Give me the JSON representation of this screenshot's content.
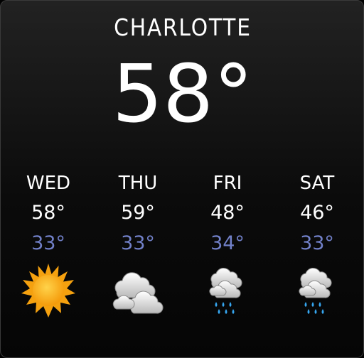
{
  "city": "CHARLOTTE",
  "current_temp": "58°",
  "forecast": [
    {
      "day": "WED",
      "high": "58°",
      "low": "33°",
      "icon": "sun-icon"
    },
    {
      "day": "THU",
      "high": "59°",
      "low": "33°",
      "icon": "cloudy-icon"
    },
    {
      "day": "FRI",
      "high": "48°",
      "low": "34°",
      "icon": "rain-icon"
    },
    {
      "day": "SAT",
      "high": "46°",
      "low": "33°",
      "icon": "rain-icon"
    }
  ],
  "colors": {
    "low_temp": "#7180c8",
    "sun": "#ffa81a"
  }
}
